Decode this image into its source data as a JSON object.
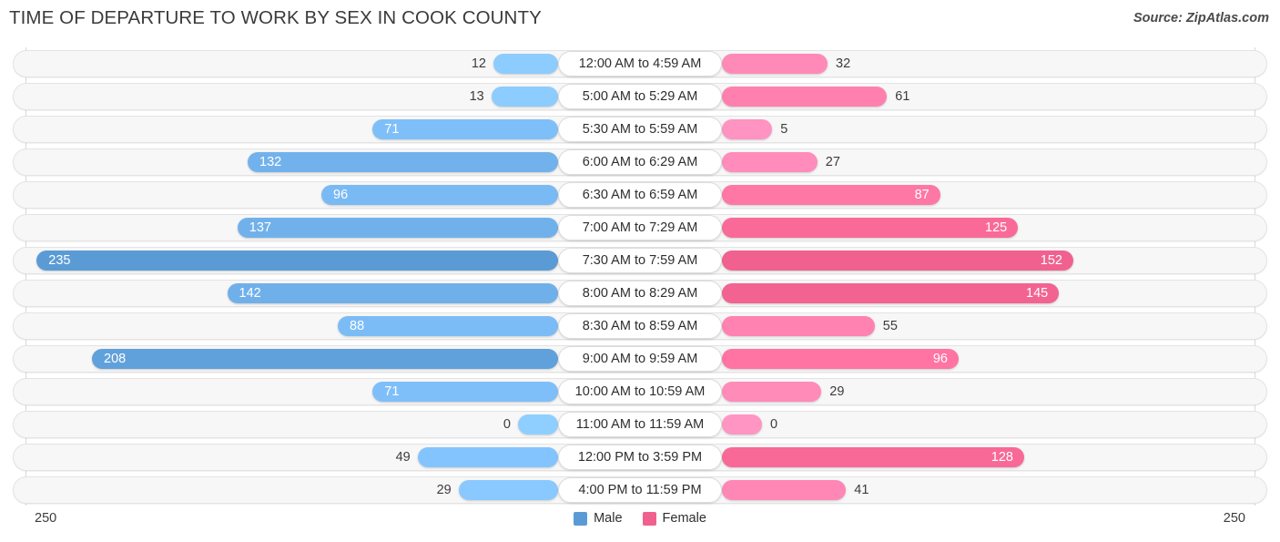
{
  "header": {
    "title": "TIME OF DEPARTURE TO WORK BY SEX IN COOK COUNTY",
    "source": "Source: ZipAtlas.com"
  },
  "legend": {
    "items": [
      {
        "label": "Male",
        "color": "#5b9bd5"
      },
      {
        "label": "Female",
        "color": "#f0618f"
      }
    ]
  },
  "axis": {
    "max_left": "250",
    "max_right": "250"
  },
  "chart_data": {
    "type": "bar",
    "orientation": "horizontal",
    "style": "diverging-bidirectional",
    "title": "TIME OF DEPARTURE TO WORK BY SEX IN COOK COUNTY",
    "xlabel": "",
    "ylabel": "",
    "xlim": [
      -250,
      250
    ],
    "axis_max": 250,
    "grid": false,
    "legend_position": "bottom-center",
    "categories": [
      "12:00 AM to 4:59 AM",
      "5:00 AM to 5:29 AM",
      "5:30 AM to 5:59 AM",
      "6:00 AM to 6:29 AM",
      "6:30 AM to 6:59 AM",
      "7:00 AM to 7:29 AM",
      "7:30 AM to 7:59 AM",
      "8:00 AM to 8:29 AM",
      "8:30 AM to 8:59 AM",
      "9:00 AM to 9:59 AM",
      "10:00 AM to 10:59 AM",
      "11:00 AM to 11:59 AM",
      "12:00 PM to 3:59 PM",
      "4:00 PM to 11:59 PM"
    ],
    "series": [
      {
        "name": "Male",
        "color": "#5b9bd5",
        "direction": "left",
        "values": [
          12,
          13,
          71,
          132,
          96,
          137,
          235,
          142,
          88,
          208,
          71,
          0,
          49,
          29
        ]
      },
      {
        "name": "Female",
        "color": "#f0618f",
        "direction": "right",
        "values": [
          32,
          61,
          5,
          27,
          87,
          125,
          152,
          145,
          55,
          96,
          29,
          0,
          128,
          41
        ]
      }
    ]
  },
  "rows": [
    {
      "category": "12:00 AM to 4:59 AM",
      "male": "12",
      "female": "32",
      "male_value": 12,
      "female_value": 32
    },
    {
      "category": "5:00 AM to 5:29 AM",
      "male": "13",
      "female": "61",
      "male_value": 13,
      "female_value": 61
    },
    {
      "category": "5:30 AM to 5:59 AM",
      "male": "71",
      "female": "5",
      "male_value": 71,
      "female_value": 5
    },
    {
      "category": "6:00 AM to 6:29 AM",
      "male": "132",
      "female": "27",
      "male_value": 132,
      "female_value": 27
    },
    {
      "category": "6:30 AM to 6:59 AM",
      "male": "96",
      "female": "87",
      "male_value": 96,
      "female_value": 87
    },
    {
      "category": "7:00 AM to 7:29 AM",
      "male": "137",
      "female": "125",
      "male_value": 137,
      "female_value": 125
    },
    {
      "category": "7:30 AM to 7:59 AM",
      "male": "235",
      "female": "152",
      "male_value": 235,
      "female_value": 152
    },
    {
      "category": "8:00 AM to 8:29 AM",
      "male": "142",
      "female": "145",
      "male_value": 142,
      "female_value": 145
    },
    {
      "category": "8:30 AM to 8:59 AM",
      "male": "88",
      "female": "55",
      "male_value": 88,
      "female_value": 55
    },
    {
      "category": "9:00 AM to 9:59 AM",
      "male": "208",
      "female": "96",
      "male_value": 208,
      "female_value": 96
    },
    {
      "category": "10:00 AM to 10:59 AM",
      "male": "71",
      "female": "29",
      "male_value": 71,
      "female_value": 29
    },
    {
      "category": "11:00 AM to 11:59 AM",
      "male": "0",
      "female": "0",
      "male_value": 0,
      "female_value": 0
    },
    {
      "category": "12:00 PM to 3:59 PM",
      "male": "49",
      "female": "128",
      "male_value": 49,
      "female_value": 128
    },
    {
      "category": "4:00 PM to 11:59 PM",
      "male": "29",
      "female": "41",
      "male_value": 29,
      "female_value": 41
    }
  ]
}
